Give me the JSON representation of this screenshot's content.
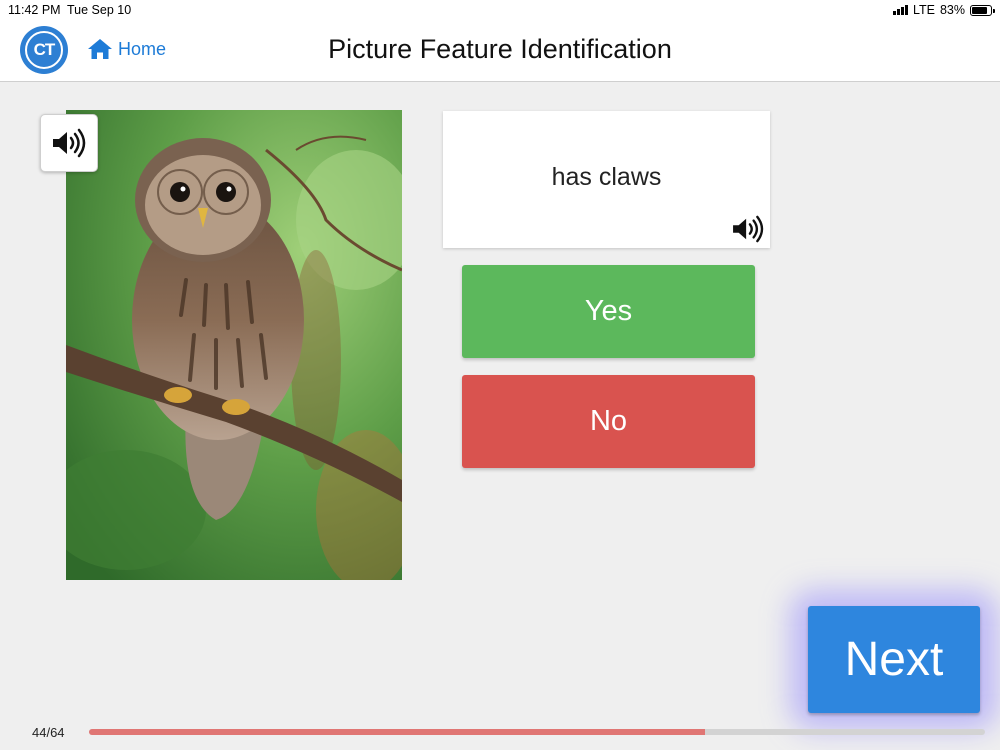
{
  "status_bar": {
    "time": "11:42 PM",
    "date": "Tue Sep 10",
    "network": "LTE",
    "battery": "83%",
    "battery_level": 0.83
  },
  "header": {
    "logo_text": "CT",
    "home_label": "Home",
    "title": "Picture Feature Identification"
  },
  "picture": {
    "icon": "owl-photo",
    "sound_icon": "speaker-icon"
  },
  "feature": {
    "text": "has claws",
    "sound_icon": "speaker-icon"
  },
  "answers": {
    "yes_label": "Yes",
    "no_label": "No"
  },
  "next_label": "Next",
  "progress": {
    "label": "44/64",
    "current": 44,
    "total": 64,
    "fraction": 0.6875
  },
  "colors": {
    "accent": "#2e86de",
    "yes": "#5cb85c",
    "no": "#d9534f",
    "progress": "#e07674"
  }
}
